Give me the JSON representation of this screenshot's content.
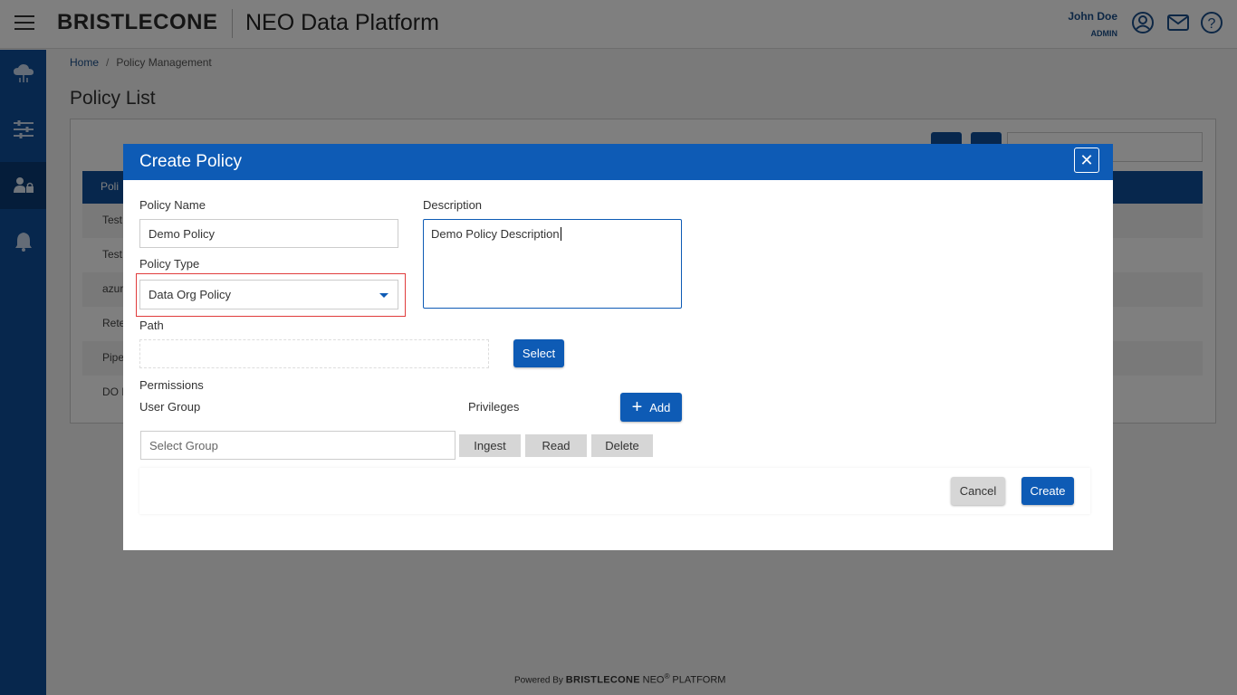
{
  "header": {
    "brand": "BRISTLECONE",
    "app_title": "NEO Data Platform",
    "user_name": "John Doe",
    "user_role": "ADMIN",
    "icons": [
      "user-icon",
      "mail-icon",
      "help-icon"
    ]
  },
  "nav": {
    "items": [
      "cloud-icon",
      "sliders-icon",
      "user-lock-icon",
      "bell-icon"
    ],
    "active": "user-lock-icon"
  },
  "breadcrumb": {
    "home": "Home",
    "separator": "/",
    "current": "Policy Management"
  },
  "page": {
    "title": "Policy List",
    "table_header": "Poli",
    "rows": [
      "Test",
      "Test",
      "azur",
      "Rete",
      "Pipe",
      "DO F"
    ]
  },
  "modal": {
    "title": "Create Policy",
    "close_symbol": "✕",
    "policy_name_label": "Policy Name",
    "policy_name_value": "Demo Policy",
    "description_label": "Description",
    "description_value": "Demo Policy Description",
    "policy_type_label": "Policy Type",
    "policy_type_value": "Data Org Policy",
    "path_label": "Path",
    "path_value": "",
    "select_button": "Select",
    "permissions_label": "Permissions",
    "user_group_label": "User Group",
    "privileges_label": "Privileges",
    "add_button": "Add",
    "select_group_placeholder": "Select Group",
    "privileges": [
      "Ingest",
      "Read",
      "Delete"
    ],
    "cancel_button": "Cancel",
    "create_button": "Create"
  },
  "footer": {
    "powered_by": "Powered By",
    "brand": "BRISTLECONE",
    "product": "NEO",
    "registered": "®",
    "platform": "PLATFORM"
  },
  "colors": {
    "primary": "#0e5bb5",
    "nav": "#0e4f9a",
    "highlight": "#e03c3c"
  }
}
